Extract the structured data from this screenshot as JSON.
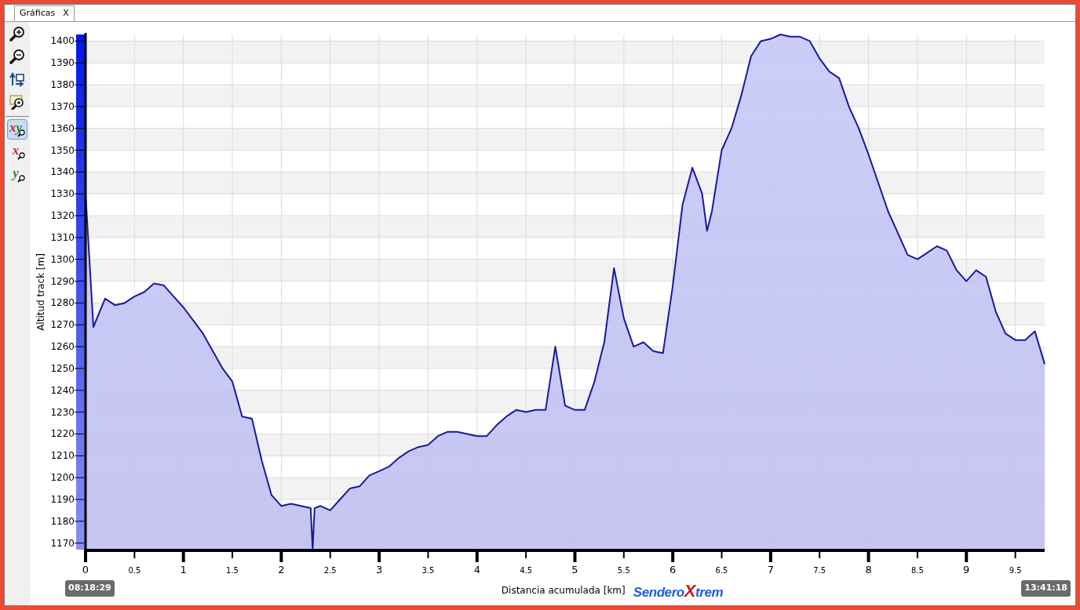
{
  "tab": {
    "label": "Gráficas",
    "close": "X",
    "selected": true
  },
  "toolbar": [
    {
      "kind": "zoom-in",
      "selected": false
    },
    {
      "kind": "zoom-out",
      "selected": false
    },
    {
      "kind": "reset",
      "selected": false
    },
    {
      "kind": "zoom-window",
      "selected": false
    },
    {
      "kind": "axis",
      "selected": true,
      "letters": [
        {
          "text": "x",
          "color": "#c0282a"
        },
        {
          "text": "y",
          "color": "#2a8a2a"
        }
      ]
    },
    {
      "kind": "axis",
      "selected": false,
      "letters": [
        {
          "text": "x",
          "color": "#c0282a"
        }
      ]
    },
    {
      "kind": "axis",
      "selected": false,
      "letters": [
        {
          "text": "y",
          "color": "#2a8a2a"
        }
      ]
    }
  ],
  "chart": {
    "chart_data": {
      "type": "area",
      "xlabel": "Distancia acumulada [km]",
      "ylabel": "Altitud track [m]",
      "x": [
        0,
        0.08,
        0.2,
        0.3,
        0.4,
        0.5,
        0.6,
        0.7,
        0.8,
        0.9,
        1,
        1.1,
        1.2,
        1.3,
        1.4,
        1.5,
        1.6,
        1.7,
        1.8,
        1.9,
        2,
        2.1,
        2.2,
        2.3,
        2.32,
        2.34,
        2.4,
        2.5,
        2.6,
        2.7,
        2.8,
        2.9,
        3,
        3.1,
        3.2,
        3.3,
        3.4,
        3.5,
        3.6,
        3.7,
        3.8,
        3.9,
        4,
        4.1,
        4.2,
        4.3,
        4.4,
        4.5,
        4.6,
        4.7,
        4.8,
        4.9,
        5,
        5.1,
        5.2,
        5.3,
        5.4,
        5.5,
        5.6,
        5.7,
        5.8,
        5.9,
        6,
        6.1,
        6.2,
        6.3,
        6.35,
        6.4,
        6.5,
        6.6,
        6.7,
        6.8,
        6.9,
        7,
        7.1,
        7.2,
        7.3,
        7.4,
        7.5,
        7.6,
        7.7,
        7.8,
        7.9,
        8,
        8.1,
        8.2,
        8.3,
        8.4,
        8.5,
        8.6,
        8.7,
        8.8,
        8.9,
        9,
        9.1,
        9.2,
        9.3,
        9.4,
        9.5,
        9.6,
        9.7,
        9.8
      ],
      "grid": true,
      "series": [
        {
          "color": "#1a1a9a",
          "values": [
            1330,
            1269,
            1282,
            1279,
            1280,
            1283,
            1285,
            1289,
            1288,
            1283,
            1278,
            1272,
            1266,
            1258,
            1250,
            1244,
            1228,
            1227,
            1208,
            1192,
            1187,
            1188,
            1187,
            1186,
            1167,
            1186,
            1187,
            1185,
            1190,
            1195,
            1196,
            1201,
            1203,
            1205,
            1209,
            1212,
            1214,
            1215,
            1219,
            1221,
            1221,
            1220,
            1219,
            1219,
            1224,
            1228,
            1231,
            1230,
            1231,
            1231,
            1260,
            1233,
            1231,
            1231,
            1244,
            1262,
            1296,
            1273,
            1260,
            1262,
            1258,
            1257,
            1288,
            1325,
            1342,
            1330,
            1313,
            1322,
            1350,
            1360,
            1375,
            1393,
            1400,
            1401,
            1403,
            1402,
            1402,
            1400,
            1392,
            1386,
            1383,
            1370,
            1360,
            1348,
            1335,
            1322,
            1312,
            1302,
            1300,
            1303,
            1306,
            1304,
            1295,
            1290,
            1295,
            1292,
            1276,
            1266,
            1263,
            1263,
            1267,
            1252
          ]
        }
      ],
      "xlim": [
        0,
        9.8
      ],
      "ylim": [
        1167,
        1403
      ],
      "xticks": [
        0,
        0.5,
        1,
        1.5,
        2,
        2.5,
        3,
        3.5,
        4,
        4.5,
        5,
        5.5,
        6,
        6.5,
        7,
        7.5,
        8,
        8.5,
        9,
        9.5
      ],
      "yticks": [
        1170,
        1180,
        1190,
        1200,
        1210,
        1220,
        1230,
        1240,
        1250,
        1260,
        1270,
        1280,
        1290,
        1300,
        1310,
        1320,
        1330,
        1340,
        1350,
        1360,
        1370,
        1380,
        1390,
        1400
      ]
    },
    "start_time": "08:18:29",
    "end_time": "13:41:18",
    "logo": "Sendero**X**trem"
  }
}
